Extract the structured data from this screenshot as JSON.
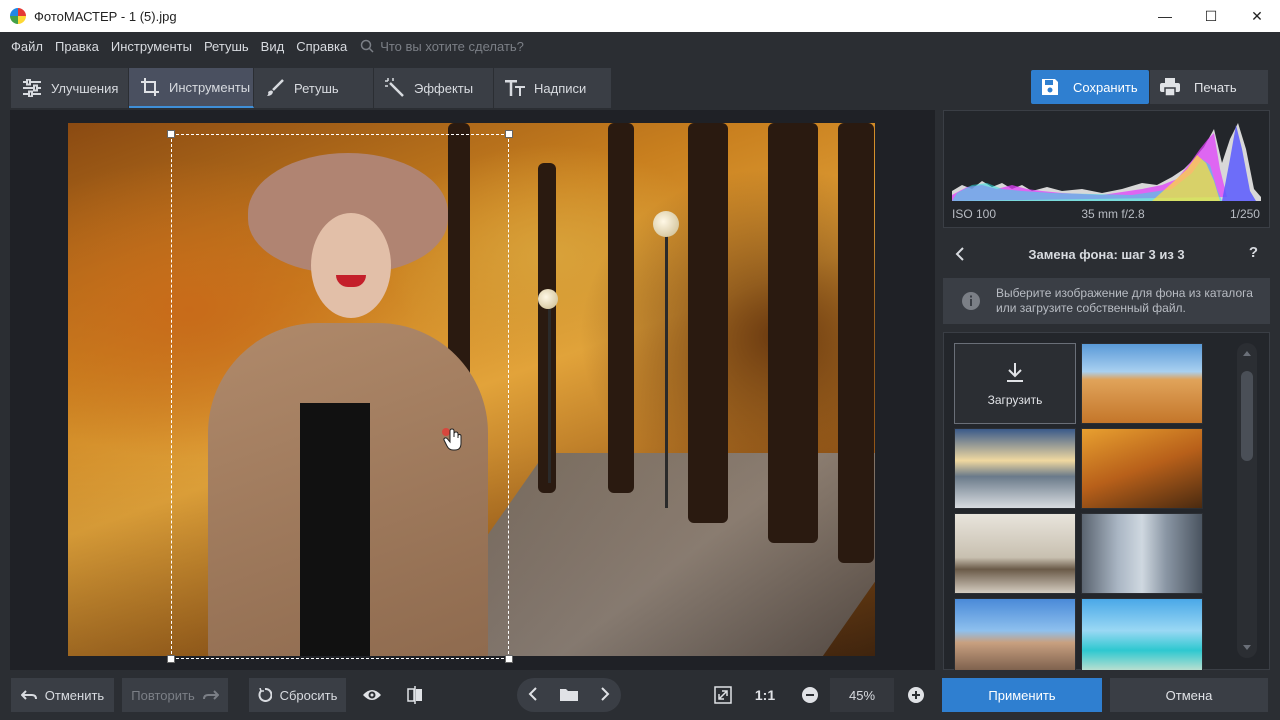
{
  "window": {
    "title": "ФотоМАСТЕР - 1 (5).jpg",
    "minimize": "—",
    "maximize": "☐",
    "close": "✕"
  },
  "menu": {
    "items": [
      "Файл",
      "Правка",
      "Инструменты",
      "Ретушь",
      "Вид",
      "Справка"
    ],
    "search_placeholder": "Что вы хотите сделать?"
  },
  "tabs": [
    {
      "label": "Улучшения",
      "icon": "sliders-icon",
      "active": false
    },
    {
      "label": "Инструменты",
      "icon": "crop-icon",
      "active": true
    },
    {
      "label": "Ретушь",
      "icon": "brush-icon",
      "active": false
    },
    {
      "label": "Эффекты",
      "icon": "magic-wand-icon",
      "active": false
    },
    {
      "label": "Надписи",
      "icon": "text-icon",
      "active": false
    }
  ],
  "toolbar": {
    "save_label": "Сохранить",
    "print_label": "Печать"
  },
  "histogram": {
    "iso": "ISO 100",
    "lens": "35 mm f/2.8",
    "shutter": "1/250"
  },
  "panel": {
    "step_title": "Замена фона: шаг 3 из 3",
    "help": "?",
    "tip": "Выберите изображение для фона из каталога или загрузите собственный файл.",
    "upload_label": "Загрузить",
    "backgrounds": [
      "desert",
      "winter-road",
      "autumn-park",
      "living-room",
      "city-street",
      "old-town",
      "tropical-beach"
    ]
  },
  "bottom": {
    "undo_label": "Отменить",
    "redo_label": "Повторить",
    "reset_label": "Сбросить",
    "zoom_fit": "1:1",
    "zoom_value": "45%",
    "apply_label": "Применить",
    "cancel_label": "Отмена"
  },
  "colors": {
    "accent": "#2f7fd0",
    "background": "#2b2e33",
    "canvas": "#1f2126"
  }
}
